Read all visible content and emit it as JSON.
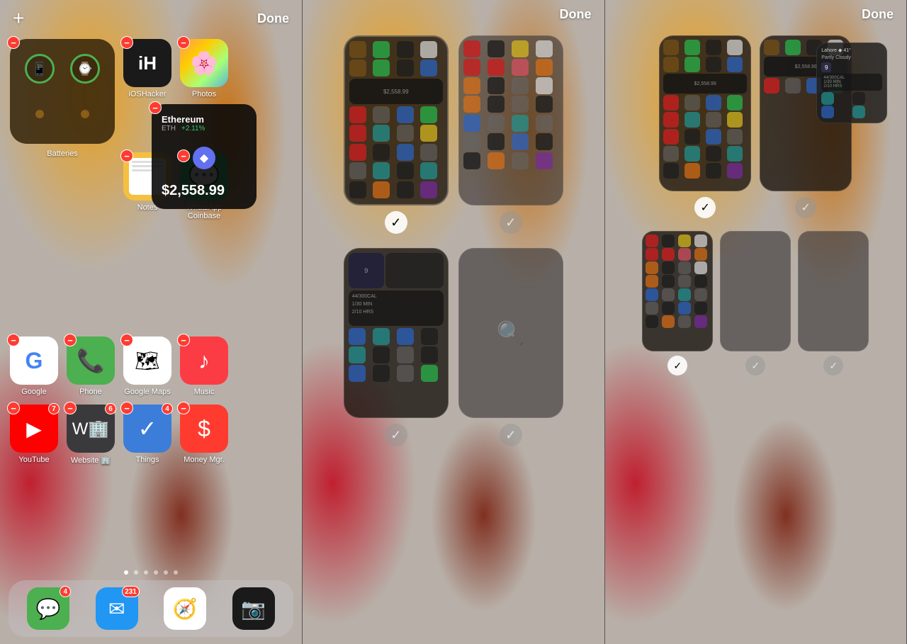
{
  "panels": {
    "panel1": {
      "plus_label": "+",
      "done_label": "Done",
      "widgets": {
        "batteries": {
          "label": "Batteries"
        },
        "coinbase": {
          "title": "Ethereum",
          "ticker": "ETH",
          "change": "+2.11%",
          "price": "$2,558.99",
          "label": "Coinbase"
        }
      },
      "apps": [
        {
          "id": "ioshacker",
          "label": "iOSHacker",
          "icon": "iH",
          "has_remove": true
        },
        {
          "id": "photos",
          "label": "Photos",
          "icon": "🌸",
          "has_remove": true
        },
        {
          "id": "notes",
          "label": "Notes",
          "icon": "📝",
          "has_remove": true
        },
        {
          "id": "whatsapp",
          "label": "WhatsApp",
          "icon": "📱",
          "has_remove": true
        },
        {
          "id": "google",
          "label": "Google",
          "icon": "G",
          "has_remove": true
        },
        {
          "id": "phone",
          "label": "Phone",
          "icon": "📞",
          "has_remove": true
        },
        {
          "id": "maps",
          "label": "Google Maps",
          "icon": "🗺",
          "has_remove": true
        },
        {
          "id": "music",
          "label": "Music",
          "icon": "♪",
          "has_remove": true
        },
        {
          "id": "youtube",
          "label": "YouTube",
          "icon": "▶",
          "badge": "7",
          "has_remove": true
        },
        {
          "id": "website",
          "label": "Website 🏢",
          "icon": "W",
          "badge": "6",
          "has_remove": true
        },
        {
          "id": "things",
          "label": "Things",
          "icon": "✓",
          "badge": "4",
          "has_remove": true
        },
        {
          "id": "moneymgr",
          "label": "Money Mgr.",
          "icon": "$",
          "has_remove": true
        }
      ],
      "dock": [
        {
          "id": "messages",
          "label": "Messages",
          "badge": "4"
        },
        {
          "id": "mail",
          "label": "Mail",
          "badge": "231"
        },
        {
          "id": "safari",
          "label": "Safari"
        },
        {
          "id": "camera",
          "label": "Camera"
        }
      ],
      "dots": 6
    },
    "panel2": {
      "done_label": "Done"
    },
    "panel3": {
      "done_label": "Done"
    }
  }
}
